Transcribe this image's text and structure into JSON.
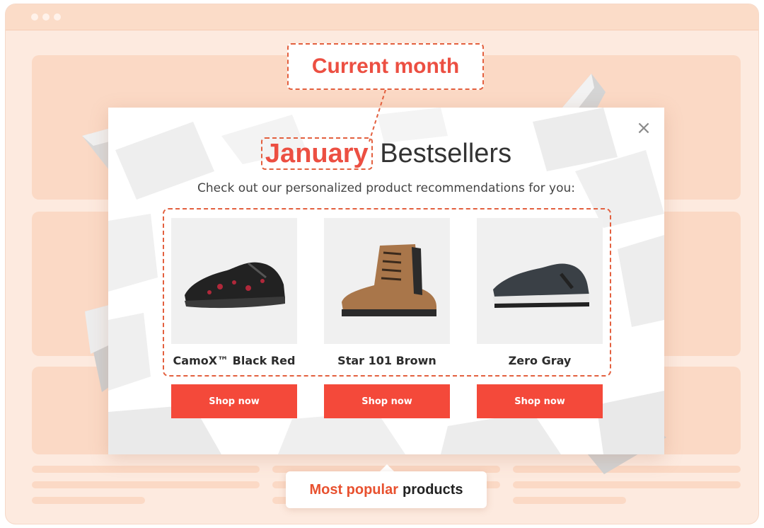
{
  "popup": {
    "headline_month": "January",
    "headline_rest": "Bestsellers",
    "subtitle": "Check out our personalized product recommendations for you:",
    "close_symbol": "×",
    "products": [
      {
        "name": "CamoX™ Black Red",
        "button": "Shop now"
      },
      {
        "name": "Star 101 Brown",
        "button": "Shop now"
      },
      {
        "name": "Zero Gray",
        "button": "Shop now"
      }
    ]
  },
  "annotations": {
    "current_month": "Current month",
    "most_popular_highlight": "Most popular",
    "most_popular_rest": "products"
  },
  "icons": {
    "close": "close-icon",
    "shoes": [
      "sneaker-black-red-icon",
      "boot-brown-icon",
      "sneaker-gray-icon"
    ]
  },
  "colors": {
    "accent": "#f4493a",
    "annotation": "#e3603f",
    "background": "#fdeadf"
  }
}
